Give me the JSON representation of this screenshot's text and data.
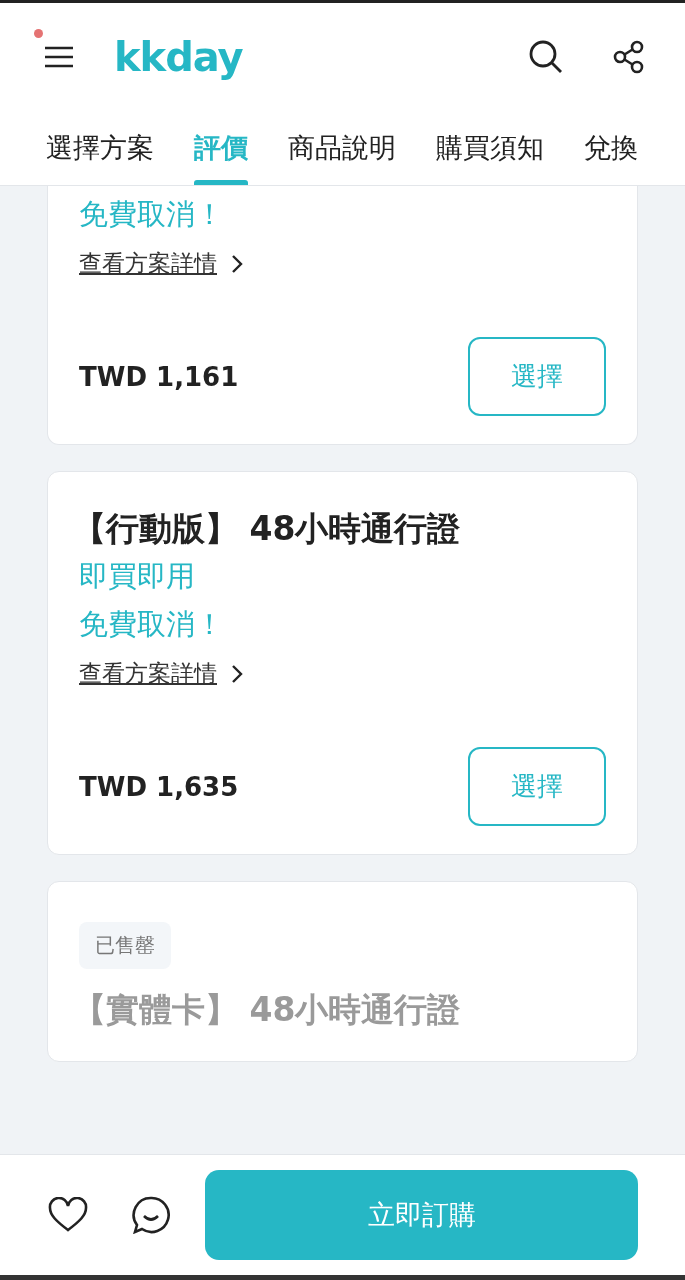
{
  "header": {
    "logo": "kkday",
    "notification": true
  },
  "tabs": [
    {
      "label": "選擇方案",
      "selected": false
    },
    {
      "label": "評價",
      "selected": true
    },
    {
      "label": "商品說明",
      "selected": false
    },
    {
      "label": "購買須知",
      "selected": false
    },
    {
      "label": "兌換",
      "selected": false
    }
  ],
  "plans": [
    {
      "kind": "cut",
      "tags": [
        "免費取消！"
      ],
      "link": "查看方案詳情",
      "price": "TWD 1,161",
      "button": "選擇",
      "sold_out": false
    },
    {
      "kind": "full",
      "title": "【行動版】 48小時通行證",
      "tags": [
        "即買即用",
        "免費取消！"
      ],
      "link": "查看方案詳情",
      "price": "TWD 1,635",
      "button": "選擇",
      "sold_out": false
    },
    {
      "kind": "full",
      "badge": "已售罄",
      "title": "【實體卡】 48小時通行證",
      "sold_out": true
    }
  ],
  "footer": {
    "book_button": "立即訂購"
  }
}
